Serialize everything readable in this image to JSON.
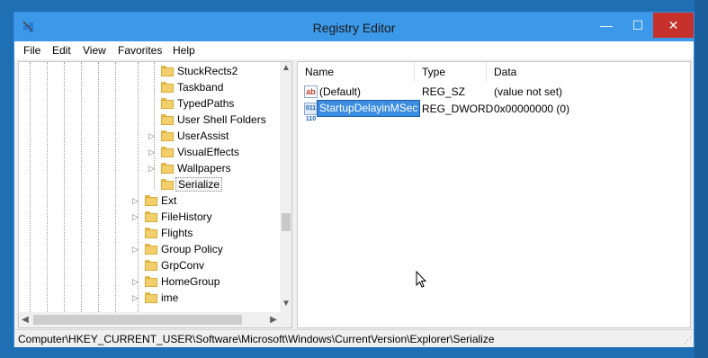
{
  "window": {
    "title": "Registry Editor",
    "controls": {
      "minimize": "—",
      "maximize": "☐",
      "close": "✕"
    }
  },
  "menu": [
    "File",
    "Edit",
    "View",
    "Favorites",
    "Help"
  ],
  "tree": [
    {
      "label": "StuckRects2",
      "expander": ""
    },
    {
      "label": "Taskband",
      "expander": ""
    },
    {
      "label": "TypedPaths",
      "expander": ""
    },
    {
      "label": "User Shell Folders",
      "expander": ""
    },
    {
      "label": "UserAssist",
      "expander": "▷"
    },
    {
      "label": "VisualEffects",
      "expander": "▷"
    },
    {
      "label": "Wallpapers",
      "expander": "▷"
    },
    {
      "label": "Serialize",
      "expander": "",
      "selected": true
    },
    {
      "label": "Ext",
      "expander": "▷"
    },
    {
      "label": "FileHistory",
      "expander": "▷"
    },
    {
      "label": "Flights",
      "expander": ""
    },
    {
      "label": "Group Policy",
      "expander": "▷"
    },
    {
      "label": "GrpConv",
      "expander": ""
    },
    {
      "label": "HomeGroup",
      "expander": "▷"
    },
    {
      "label": "ime",
      "expander": "▷"
    }
  ],
  "columns": {
    "name": "Name",
    "type": "Type",
    "data": "Data"
  },
  "values": [
    {
      "name": "(Default)",
      "type": "REG_SZ",
      "data": "(value not set)",
      "icon": "string-value-icon",
      "icon_glyph": "ab"
    },
    {
      "name": "StartupDelayinMSec",
      "type": "REG_DWORD",
      "data": "0x00000000 (0)",
      "icon": "dword-value-icon",
      "icon_glyph": "011 110",
      "editing": true
    }
  ],
  "status": {
    "path": "Computer\\HKEY_CURRENT_USER\\Software\\Microsoft\\Windows\\CurrentVersion\\Explorer\\Serialize"
  },
  "colors": {
    "titlebar": "#3c98e8",
    "close": "#c7312b",
    "selection": "#3c8de0",
    "desktop": "#1f6fb5"
  }
}
